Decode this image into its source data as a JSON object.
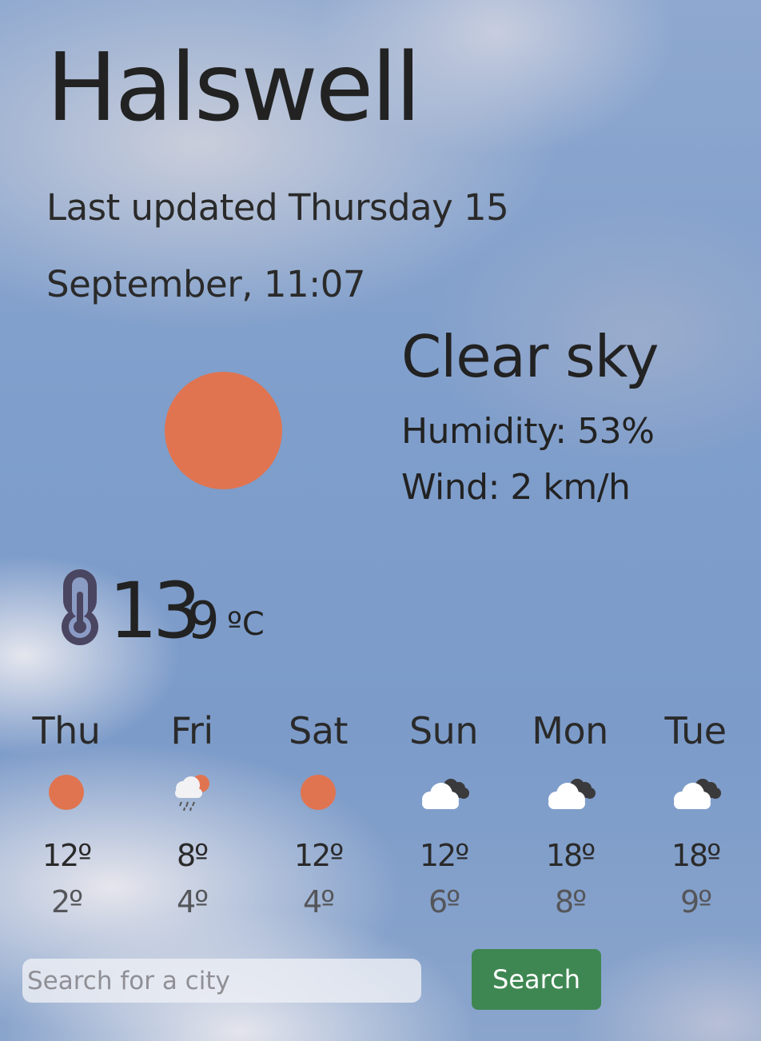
{
  "current": {
    "city": "Halswell",
    "updated_line1": "Last updated Thursday 15",
    "updated_line2": "September, 11:07",
    "description": "Clear sky",
    "humidity": "Humidity: 53%",
    "wind": "Wind: 2 km/h",
    "temp_main": "13",
    "temp_second": "9",
    "temp_unit": "ºC",
    "icon": "sun-icon"
  },
  "forecast": [
    {
      "day": "Thu",
      "max": "12º",
      "min": "2º",
      "icon": "sun-icon"
    },
    {
      "day": "Fri",
      "max": "8º",
      "min": "4º",
      "icon": "rain-sun-cloud-icon"
    },
    {
      "day": "Sat",
      "max": "12º",
      "min": "4º",
      "icon": "sun-icon"
    },
    {
      "day": "Sun",
      "max": "12º",
      "min": "6º",
      "icon": "cloudy-icon"
    },
    {
      "day": "Mon",
      "max": "18º",
      "min": "8º",
      "icon": "cloudy-icon"
    },
    {
      "day": "Tue",
      "max": "18º",
      "min": "9º",
      "icon": "cloudy-icon"
    }
  ],
  "search": {
    "placeholder": "Search for a city",
    "button_label": "Search"
  },
  "colors": {
    "sun": "#e07450",
    "button": "#3f8752",
    "thermometer": "#4a4560"
  }
}
